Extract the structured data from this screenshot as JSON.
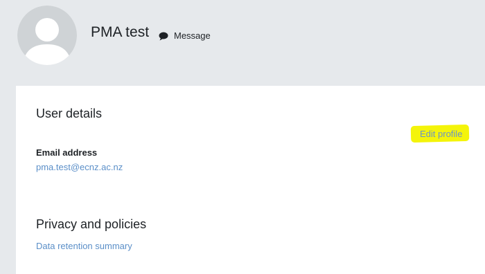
{
  "header": {
    "avatar_icon": "default-user-avatar-icon",
    "user_name": "PMA test",
    "message_icon": "speech-bubble-icon",
    "message_label": "Message"
  },
  "user_details": {
    "heading": "User details",
    "edit_profile_label": "Edit profile",
    "edit_profile_highlight_color": "#f4f40a",
    "email_label": "Email address",
    "email_value": "pma.test@ecnz.ac.nz"
  },
  "privacy": {
    "heading": "Privacy and policies",
    "data_retention_label": "Data retention summary"
  },
  "colors": {
    "page_background": "#e6e9ec",
    "card_background": "#ffffff",
    "link": "#5b8fc8",
    "text": "#1d2125"
  }
}
